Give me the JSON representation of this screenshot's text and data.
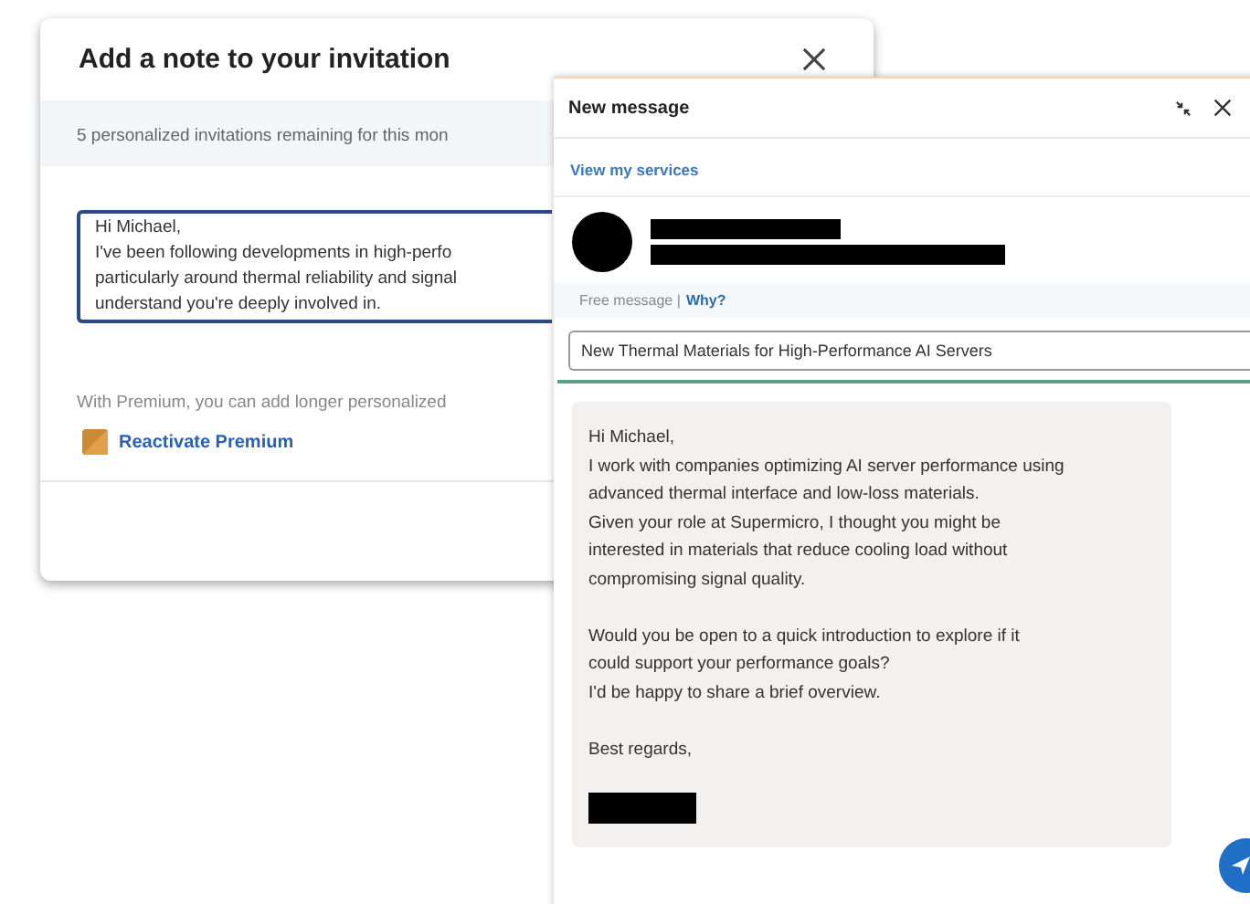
{
  "invitation_dialog": {
    "title": "Add a note to your invitation",
    "notice": "5 personalized invitations remaining for this mon",
    "note_lines": [
      "Hi Michael,",
      "I've been following developments in high-perfo",
      "particularly around thermal reliability and signal",
      "understand you're deeply involved in."
    ],
    "premium_text": "With Premium, you can add longer personalized",
    "premium_link": "Reactivate Premium"
  },
  "message_window": {
    "title": "New message",
    "services_link": "View my services",
    "free_message": "Free message |",
    "why_link": "Why?",
    "subject": "New Thermal Materials for High-Performance AI Servers",
    "body_paragraphs": [
      [
        "Hi Michael,",
        "I work with companies optimizing AI server performance using",
        "advanced thermal interface and low-loss materials.",
        "Given your role at Supermicro, I thought you might be",
        "interested in materials that reduce cooling load without",
        "compromising signal quality."
      ],
      [
        "Would you be open to a quick introduction to explore if it",
        "could support your performance goals?",
        "I'd be happy to share a brief overview."
      ],
      [
        "Best regards,"
      ]
    ]
  }
}
